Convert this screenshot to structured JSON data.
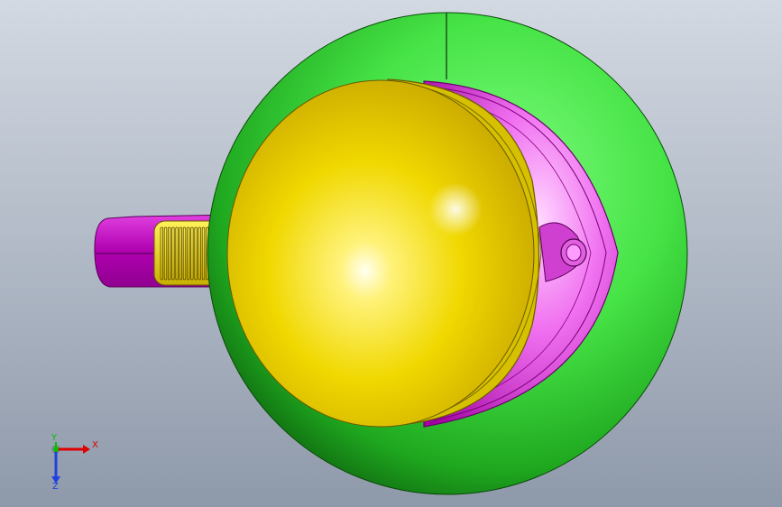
{
  "viewport": {
    "background_top": "#cfd6e0",
    "background_bottom": "#8f9aab"
  },
  "model": {
    "body_color": "#3ddc3d",
    "lid_color": "#e8d400",
    "spout_color": "#cc00cc",
    "handle_color": "#c800c8",
    "grip_color": "#f0e000"
  },
  "triad": {
    "x_label": "X",
    "y_label": "Y",
    "z_label": "Z",
    "x_color": "#e00000",
    "y_color": "#00c000",
    "z_color": "#2040e0"
  }
}
